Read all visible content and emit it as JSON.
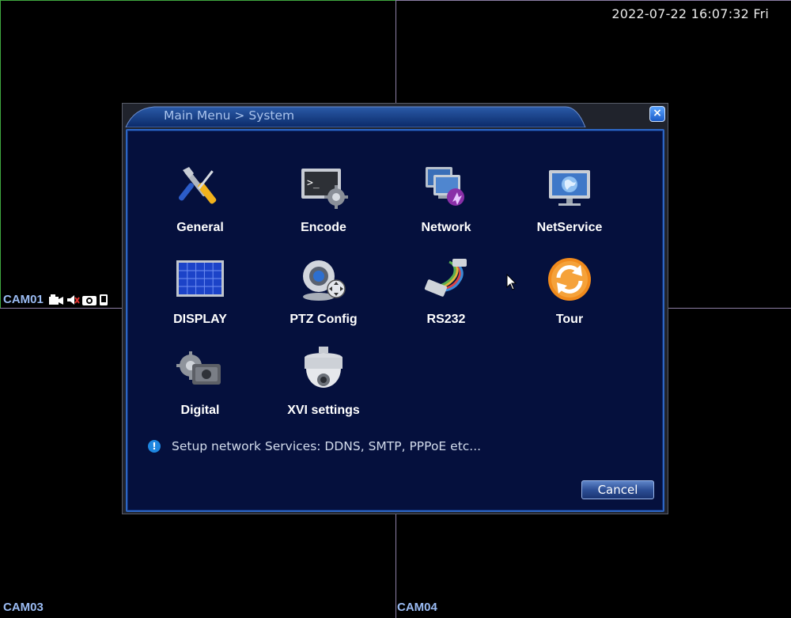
{
  "clock": "2022-07-22 16:07:32 Fri",
  "cameras": {
    "cam01": "CAM01",
    "cam03": "CAM03",
    "cam04": "CAM04"
  },
  "status_icons": [
    "record-icon",
    "mute-icon",
    "snapshot-icon",
    "phone-icon"
  ],
  "dialog": {
    "title": "Main Menu > System",
    "close_label": "×",
    "items": [
      {
        "label": "General",
        "icon": "tools-icon"
      },
      {
        "label": "Encode",
        "icon": "encode-terminal-gear-icon"
      },
      {
        "label": "Network",
        "icon": "network-computers-icon"
      },
      {
        "label": "NetService",
        "icon": "globe-monitor-icon"
      },
      {
        "label": "DISPLAY",
        "icon": "display-grid-icon"
      },
      {
        "label": "PTZ Config",
        "icon": "ptz-camera-icon"
      },
      {
        "label": "RS232",
        "icon": "rs232-cable-icon"
      },
      {
        "label": "Tour",
        "icon": "tour-cycle-icon"
      },
      {
        "label": "Digital",
        "icon": "digital-camera-gear-icon"
      },
      {
        "label": "XVI settings",
        "icon": "dome-camera-icon"
      }
    ],
    "hint_icon": "!",
    "hint": "Setup network Services: DDNS, SMTP, PPPoE etc...",
    "cancel_label": "Cancel"
  },
  "colors": {
    "panel_bg": "#05103d",
    "panel_border": "#2d66c4",
    "title_text": "#a9c3ec",
    "cam_label": "#9bbcf4"
  }
}
